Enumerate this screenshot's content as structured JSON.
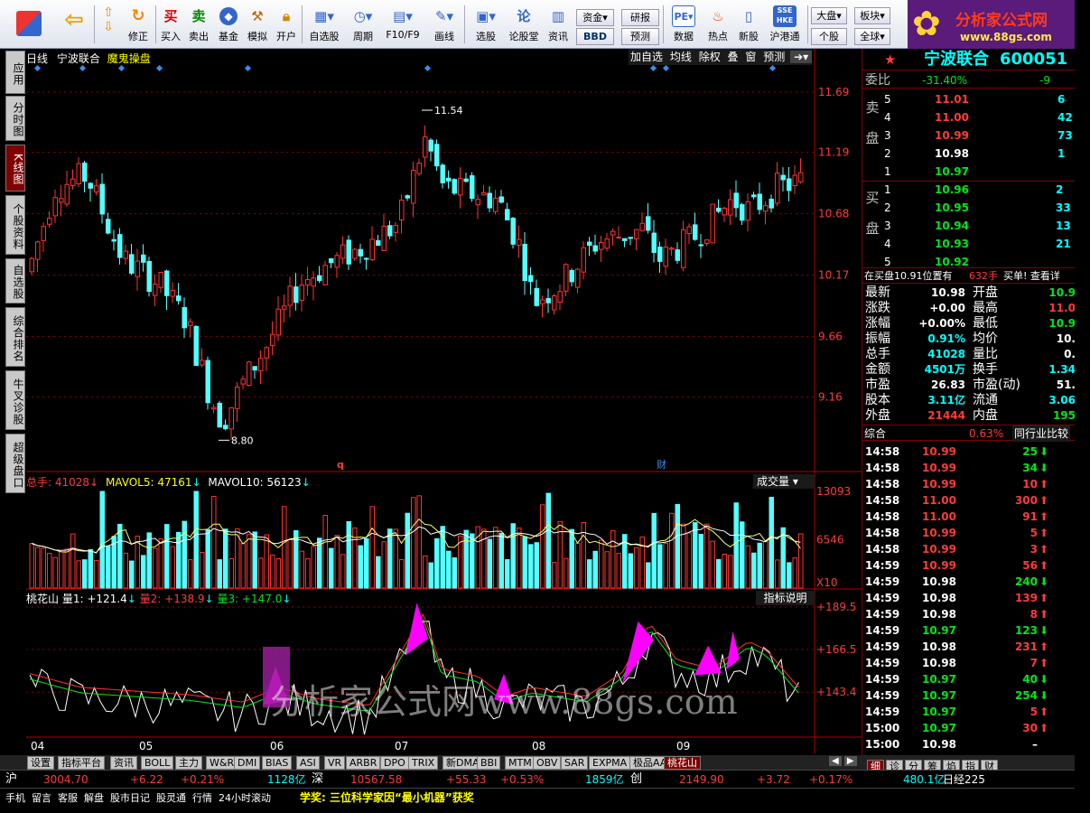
{
  "toolbar": {
    "buttons": [
      {
        "label": "",
        "icon": "grid-icon"
      },
      {
        "label": "",
        "icon": "back-arrow-icon"
      },
      {
        "label": "修正",
        "icon": "up-down-icon"
      },
      {
        "label": "买入",
        "icon": "buy-icon"
      },
      {
        "label": "卖出",
        "icon": "sell-icon"
      },
      {
        "label": "基金",
        "icon": "fund-icon"
      },
      {
        "label": "模拟",
        "icon": "hammer-icon"
      },
      {
        "label": "开户",
        "icon": "lock-icon"
      },
      {
        "label": "自选股",
        "icon": "star-list-icon"
      },
      {
        "label": "周期",
        "icon": "clock-icon"
      },
      {
        "label": "F10/F9",
        "icon": "info-icon"
      },
      {
        "label": "画线",
        "icon": "pen-icon"
      },
      {
        "label": "选股",
        "icon": "screen-icon"
      },
      {
        "label": "论股堂",
        "icon": "lun-icon"
      },
      {
        "label": "资讯",
        "icon": "news-icon"
      }
    ],
    "fund_btn": "资金",
    "bbd_btn": "BBD",
    "yanbao_btn": "研报",
    "yuce_btn": "预测",
    "more_buttons": [
      {
        "label": "数据",
        "icon": "pe-icon"
      },
      {
        "label": "热点",
        "icon": "fire-icon"
      },
      {
        "label": "新股",
        "icon": "newstock-icon"
      },
      {
        "label": "沪港通",
        "icon": "hkex-icon"
      }
    ],
    "right_btns": [
      "大盘",
      "板块",
      "个股",
      "全球"
    ]
  },
  "logo": {
    "title": "分析家公式网",
    "url": "www.88gs.com"
  },
  "left_tabs": [
    "应用",
    "分时图",
    "K线图",
    "个股资料",
    "自选股",
    "综合排名",
    "牛叉诊股",
    "超级盘口"
  ],
  "left_active": 2,
  "chart": {
    "period": "日线",
    "stock_name": "宁波联合",
    "indicator_name": "魔鬼操盘",
    "buttons": [
      "加自选",
      "均线",
      "除权",
      "叠",
      "窗",
      "预测"
    ],
    "price_axis": [
      "11.69",
      "11.19",
      "10.68",
      "10.17",
      "9.66",
      "9.16"
    ],
    "high_label": "11.54",
    "low_label": "8.80",
    "vol_title": "总手: 41028",
    "mavol5": "MAVOL5: 47161",
    "mavol10": "MAVOL10: 56123",
    "vol_btn": "成交量",
    "vol_axis": [
      "13093",
      "6546"
    ],
    "vol_unit": "X10",
    "ind_name": "桃花山",
    "q1": "量1: +121.4",
    "q2": "量2: +138.9",
    "q3": "量3: +147.0",
    "ind_btn": "指标说明",
    "ind_axis": [
      "+189.5",
      "+166.5",
      "+143.4"
    ],
    "months": [
      "04",
      "05",
      "06",
      "07",
      "08",
      "09"
    ],
    "markers": [
      "q",
      "财"
    ],
    "watermark": "分析家公式网www.88gs.com"
  },
  "chart_data": {
    "type": "candlestick",
    "title": "宁波联合 日线",
    "ylim": [
      8.6,
      11.9
    ],
    "high": 11.54,
    "low": 8.8,
    "last_volume": 41028,
    "mavol5": 47161,
    "mavol10": 56123,
    "indicator": {
      "name": "桃花山",
      "q1": 121.4,
      "q2": 138.9,
      "q3": 147.0
    }
  },
  "quote": {
    "name": "宁波联合",
    "code": "600051",
    "weibi_label": "委比",
    "weibi": "-31.40%",
    "weicha": "-9",
    "sell_label": "卖盘",
    "buy_label": "买盘",
    "asks": [
      {
        "n": "5",
        "p": "11.01",
        "v": "6"
      },
      {
        "n": "4",
        "p": "11.00",
        "v": "42"
      },
      {
        "n": "3",
        "p": "10.99",
        "v": "73"
      },
      {
        "n": "2",
        "p": "10.98",
        "v": "1"
      },
      {
        "n": "1",
        "p": "10.97",
        "v": ""
      }
    ],
    "bids": [
      {
        "n": "1",
        "p": "10.96",
        "v": "2"
      },
      {
        "n": "2",
        "p": "10.95",
        "v": "33"
      },
      {
        "n": "3",
        "p": "10.94",
        "v": "13"
      },
      {
        "n": "4",
        "p": "10.93",
        "v": "21"
      },
      {
        "n": "5",
        "p": "10.92",
        "v": ""
      }
    ],
    "notice": "在买盘10.91位置有",
    "notice_v": "632手",
    "notice_r": "买单! 查看详",
    "stats": [
      {
        "l": "最新",
        "v": "10.98",
        "c": "wht",
        "l2": "开盘",
        "v2": "10.9",
        "c2": "grn"
      },
      {
        "l": "涨跌",
        "v": "+0.00",
        "c": "wht",
        "l2": "最高",
        "v2": "11.0",
        "c2": "red"
      },
      {
        "l": "涨幅",
        "v": "+0.00%",
        "c": "wht",
        "l2": "最低",
        "v2": "10.9",
        "c2": "grn"
      },
      {
        "l": "振幅",
        "v": "0.91%",
        "c": "cy",
        "l2": "均价",
        "v2": "10.",
        "c2": "wht"
      },
      {
        "l": "总手",
        "v": "41028",
        "c": "cy",
        "l2": "量比",
        "v2": "0.",
        "c2": "wht"
      },
      {
        "l": "金额",
        "v": "4501万",
        "c": "cy",
        "l2": "换手",
        "v2": "1.34",
        "c2": "cy"
      },
      {
        "l": "市盈",
        "v": "26.83",
        "c": "wht",
        "l2": "市盈(动)",
        "v2": "51.",
        "c2": "wht"
      },
      {
        "l": "股本",
        "v": "3.11亿",
        "c": "cy",
        "l2": "流通",
        "v2": "3.06",
        "c2": "cy"
      },
      {
        "l": "外盘",
        "v": "21444",
        "c": "red",
        "l2": "内盘",
        "v2": "195",
        "c2": "grn"
      }
    ],
    "zonghe": "综合",
    "zonghe_v": "0.63%",
    "peer_btn": "同行业比较",
    "ticks": [
      {
        "t": "14:58",
        "p": "10.99",
        "pc": "red",
        "v": "25",
        "d": "down"
      },
      {
        "t": "14:58",
        "p": "10.99",
        "pc": "red",
        "v": "34",
        "d": "down"
      },
      {
        "t": "14:58",
        "p": "10.99",
        "pc": "red",
        "v": "10",
        "d": "up"
      },
      {
        "t": "14:58",
        "p": "11.00",
        "pc": "red",
        "v": "300",
        "d": "up"
      },
      {
        "t": "14:58",
        "p": "11.00",
        "pc": "red",
        "v": "91",
        "d": "up"
      },
      {
        "t": "14:58",
        "p": "10.99",
        "pc": "red",
        "v": "5",
        "d": "up"
      },
      {
        "t": "14:58",
        "p": "10.99",
        "pc": "red",
        "v": "3",
        "d": "up"
      },
      {
        "t": "14:59",
        "p": "10.99",
        "pc": "red",
        "v": "56",
        "d": "up"
      },
      {
        "t": "14:59",
        "p": "10.98",
        "pc": "wht",
        "v": "240",
        "d": "down"
      },
      {
        "t": "14:59",
        "p": "10.98",
        "pc": "wht",
        "v": "139",
        "d": "up"
      },
      {
        "t": "14:59",
        "p": "10.98",
        "pc": "wht",
        "v": "8",
        "d": "up"
      },
      {
        "t": "14:59",
        "p": "10.97",
        "pc": "grn",
        "v": "123",
        "d": "down"
      },
      {
        "t": "14:59",
        "p": "10.98",
        "pc": "wht",
        "v": "231",
        "d": "up"
      },
      {
        "t": "14:59",
        "p": "10.98",
        "pc": "wht",
        "v": "7",
        "d": "up"
      },
      {
        "t": "14:59",
        "p": "10.97",
        "pc": "grn",
        "v": "40",
        "d": "down"
      },
      {
        "t": "14:59",
        "p": "10.97",
        "pc": "grn",
        "v": "254",
        "d": "down"
      },
      {
        "t": "14:59",
        "p": "10.97",
        "pc": "grn",
        "v": "5",
        "d": "up"
      },
      {
        "t": "15:00",
        "p": "10.97",
        "pc": "grn",
        "v": "30",
        "d": "up"
      },
      {
        "t": "15:00",
        "p": "10.98",
        "pc": "wht",
        "v": "–",
        "d": ""
      }
    ],
    "bottom_tabs": [
      "细",
      "诊",
      "分",
      "筹",
      "焰",
      "指",
      "财"
    ]
  },
  "bottom_tabs": [
    "设置",
    "指标平台",
    "资讯",
    "BOLL",
    "主力",
    "W&R",
    "DMI",
    "BIAS",
    "ASI",
    "VR",
    "ARBR",
    "DPO",
    "TRIX",
    "新DMA",
    "BBI",
    "MTM",
    "OBV",
    "SAR",
    "EXPMA",
    "极品AA",
    "桃花山"
  ],
  "status": {
    "sh": "沪",
    "sh_idx": "3004.70",
    "sh_chg": "+6.22",
    "sh_pct": "+0.21%",
    "sh_amt": "1128亿",
    "sz": "深",
    "sz_idx": "10567.58",
    "sz_chg": "+55.33",
    "sz_pct": "+0.53%",
    "sz_amt": "1859亿",
    "cy": "创",
    "cy_idx": "2149.90",
    "cy_chg": "+3.72",
    "cy_pct": "+0.17%",
    "cy_amt": "480.1亿",
    "rj": "日经225"
  },
  "status2": {
    "items": [
      "手机",
      "留言",
      "客服",
      "解盘",
      "股市日记",
      "股灵通",
      "行情",
      "24小时滚动"
    ],
    "news": "学奖: 三位科学家因“最小机器”获奖"
  }
}
